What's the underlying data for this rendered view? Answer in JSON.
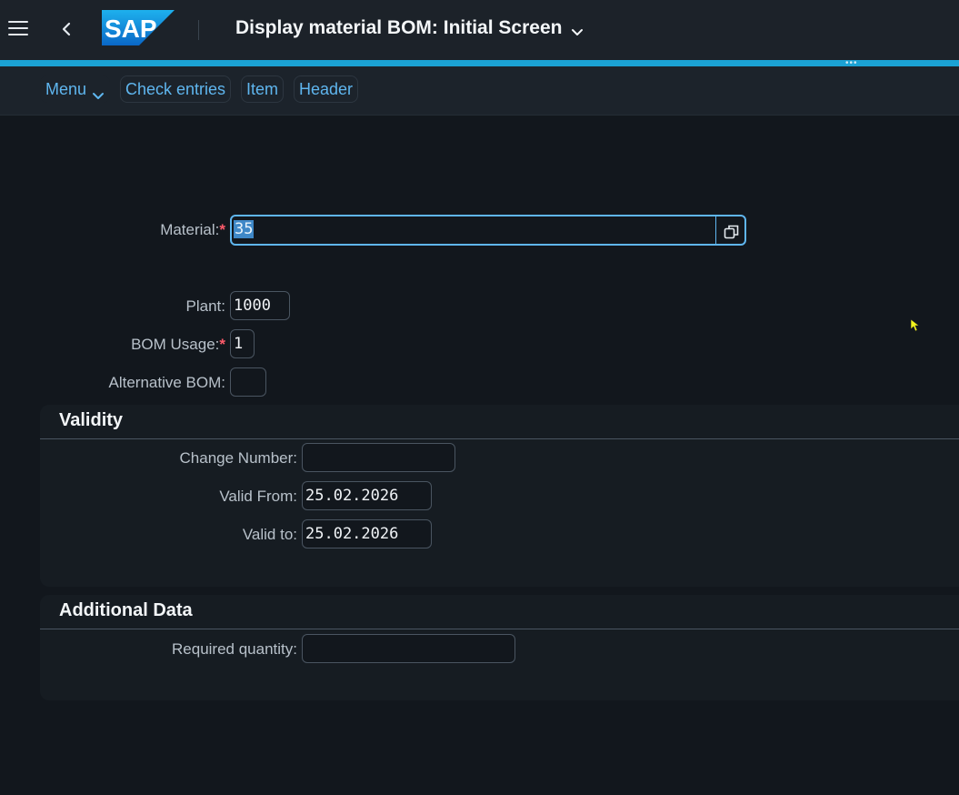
{
  "shell": {
    "logo_text": "SAP",
    "title": "Display material BOM: Initial Screen",
    "overflow": "•••"
  },
  "toolbar": {
    "menu_label": "Menu",
    "check_entries_label": "Check entries",
    "item_label": "Item",
    "header_label": "Header"
  },
  "form": {
    "material": {
      "label": "Material:",
      "required_mark": "*",
      "value": "35"
    },
    "plant": {
      "label": "Plant:",
      "value": "1000"
    },
    "bom_usage": {
      "label": "BOM Usage:",
      "required_mark": "*",
      "value": "1"
    },
    "alternative_bom": {
      "label": "Alternative BOM:",
      "value": ""
    }
  },
  "validity": {
    "title": "Validity",
    "change_number": {
      "label": "Change Number:",
      "value": ""
    },
    "valid_from": {
      "label": "Valid From:",
      "value": "25.02.2026"
    },
    "valid_to": {
      "label": "Valid to:",
      "value": "25.02.2026"
    }
  },
  "additional": {
    "title": "Additional Data",
    "required_quantity": {
      "label": "Required quantity:",
      "value": ""
    }
  },
  "colors": {
    "accent": "#1ba2d4",
    "link": "#5fb6ef",
    "required": "#ff5b6b",
    "background": "#12171d"
  }
}
